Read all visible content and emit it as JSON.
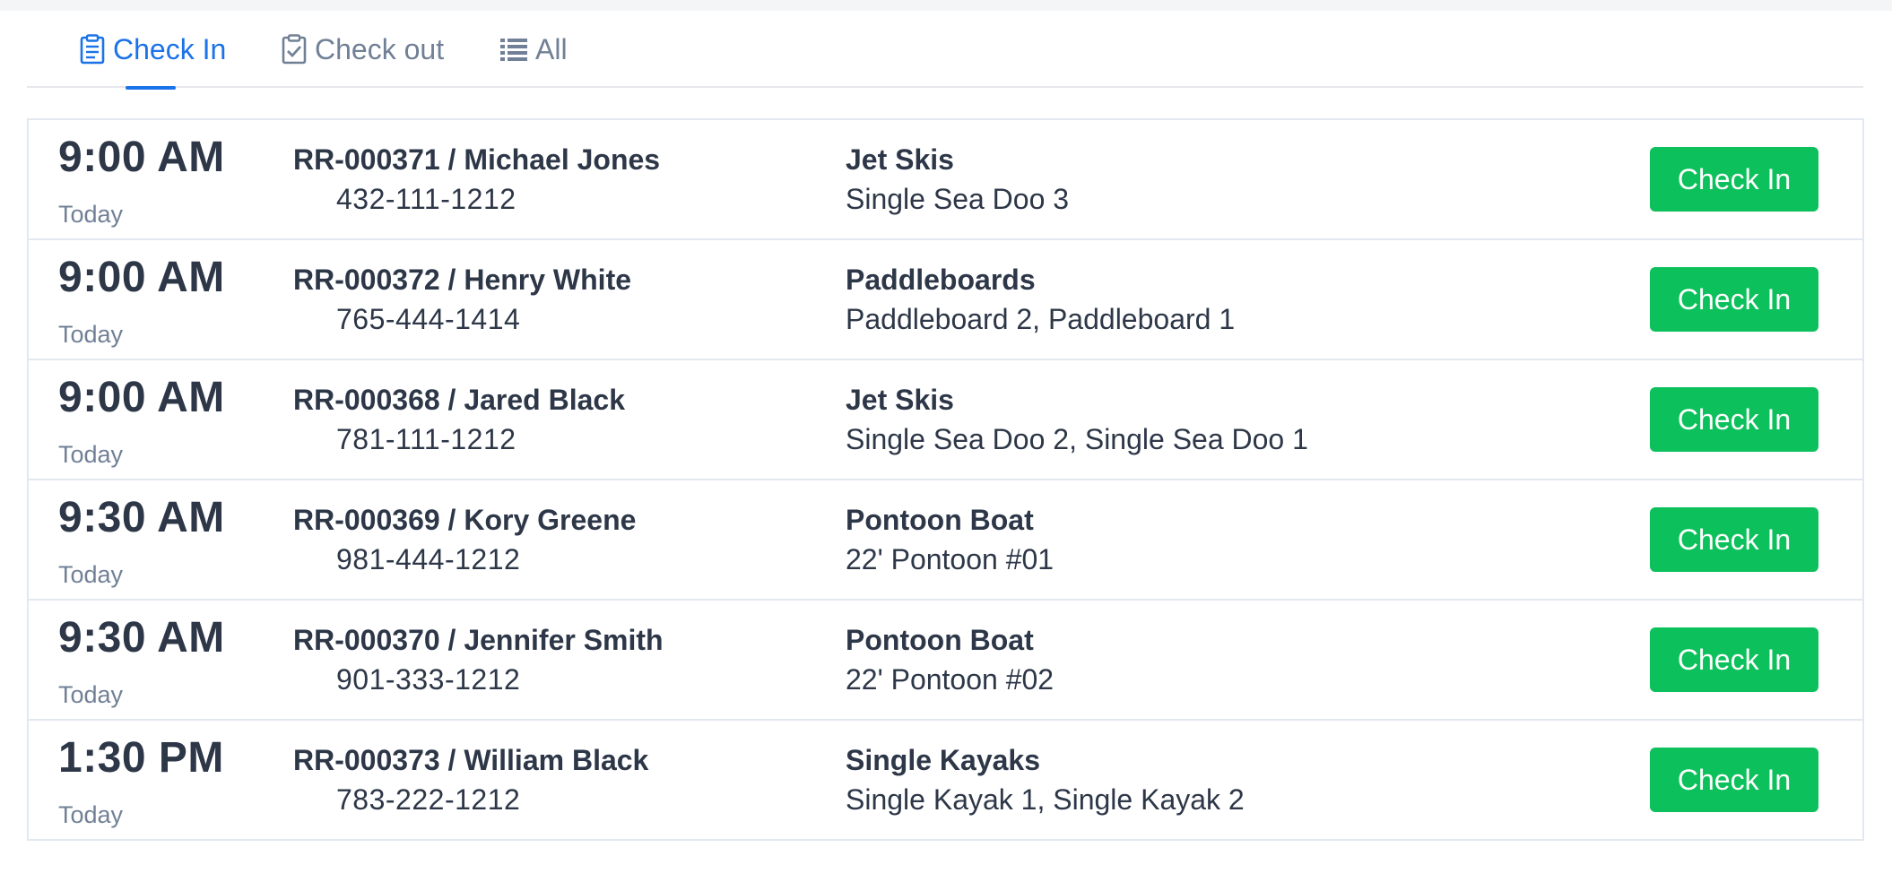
{
  "tabs": [
    {
      "label": "Check In",
      "icon": "clipboard-list-icon",
      "active": true
    },
    {
      "label": "Check out",
      "icon": "clipboard-check-icon",
      "active": false
    },
    {
      "label": "All",
      "icon": "list-icon",
      "active": false
    }
  ],
  "colors": {
    "accent": "#1a73e8",
    "button": "#0cc15b",
    "text": "#2d3748",
    "muted": "#718096",
    "border": "#e2e8f0"
  },
  "reservations": [
    {
      "time": "9:00 AM",
      "day": "Today",
      "reservation": "RR-000371 / Michael Jones",
      "phone": "432-111-1212",
      "category": "Jet Skis",
      "items": "Single Sea Doo 3",
      "action": "Check In"
    },
    {
      "time": "9:00 AM",
      "day": "Today",
      "reservation": "RR-000372 / Henry White",
      "phone": "765-444-1414",
      "category": "Paddleboards",
      "items": "Paddleboard 2, Paddleboard 1",
      "action": "Check In"
    },
    {
      "time": "9:00 AM",
      "day": "Today",
      "reservation": "RR-000368 / Jared Black",
      "phone": "781-111-1212",
      "category": "Jet Skis",
      "items": "Single Sea Doo 2, Single Sea Doo 1",
      "action": "Check In"
    },
    {
      "time": "9:30 AM",
      "day": "Today",
      "reservation": "RR-000369 / Kory Greene",
      "phone": "981-444-1212",
      "category": "Pontoon Boat",
      "items": "22' Pontoon #01",
      "action": "Check In"
    },
    {
      "time": "9:30 AM",
      "day": "Today",
      "reservation": "RR-000370 / Jennifer Smith",
      "phone": "901-333-1212",
      "category": "Pontoon Boat",
      "items": "22' Pontoon #02",
      "action": "Check In"
    },
    {
      "time": "1:30 PM",
      "day": "Today",
      "reservation": "RR-000373 / William Black",
      "phone": "783-222-1212",
      "category": "Single Kayaks",
      "items": "Single Kayak 1, Single Kayak 2",
      "action": "Check In"
    }
  ]
}
